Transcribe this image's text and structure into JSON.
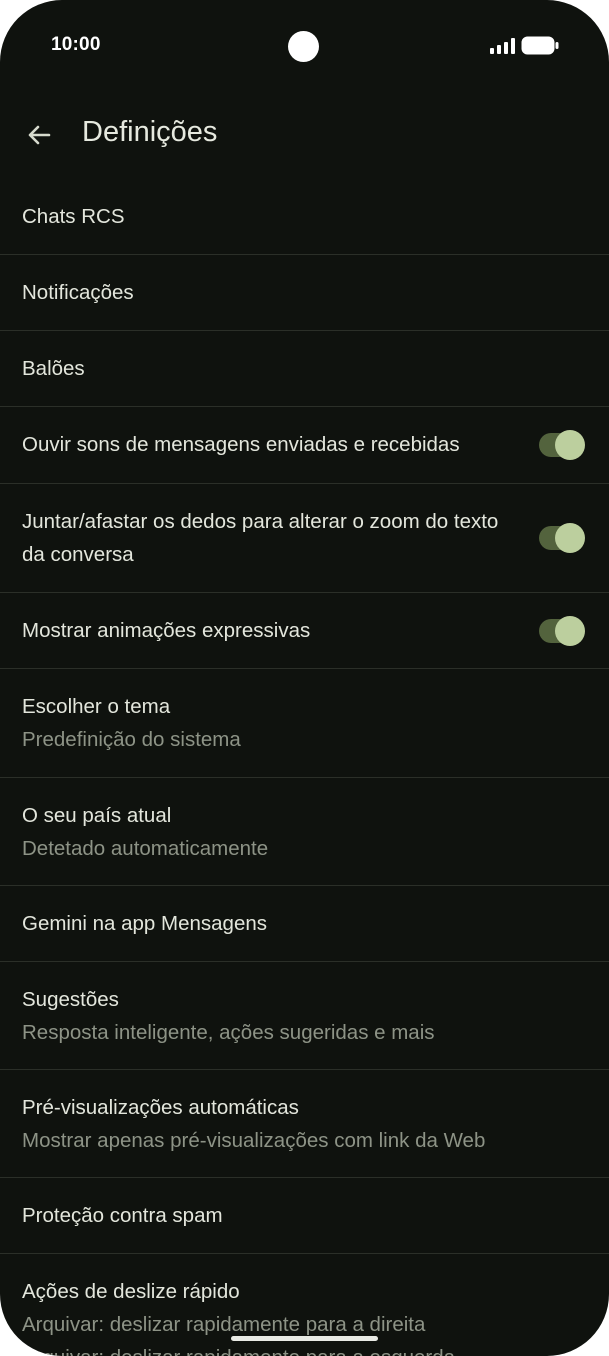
{
  "status_bar": {
    "time": "10:00"
  },
  "header": {
    "title": "Definições"
  },
  "settings": [
    {
      "primary": "Chats RCS"
    },
    {
      "primary": "Notificações"
    },
    {
      "primary": "Balões"
    },
    {
      "primary": "Ouvir sons de mensagens enviadas e recebidas",
      "toggle": true
    },
    {
      "primary": "Juntar/afastar os dedos para alterar o zoom do texto da conversa",
      "toggle": true
    },
    {
      "primary": "Mostrar animações expressivas",
      "toggle": true
    },
    {
      "primary": "Escolher o tema",
      "secondary": "Predefinição do sistema"
    },
    {
      "primary": "O seu país atual",
      "secondary": "Detetado automaticamente"
    },
    {
      "primary": "Gemini na app Mensagens"
    },
    {
      "primary": "Sugestões",
      "secondary": "Resposta inteligente, ações sugeridas e mais"
    },
    {
      "primary": "Pré-visualizações automáticas",
      "secondary": "Mostrar apenas pré-visualizações com link da Web"
    },
    {
      "primary": "Proteção contra spam"
    },
    {
      "primary": "Ações de deslize rápido",
      "secondary": "Arquivar: deslizar rapidamente para a direita",
      "secondary2": "Arquivar: deslizar rapidamente para a esquerda"
    }
  ],
  "colors": {
    "background": "#0f120e",
    "toggle_track": "#53633d",
    "toggle_knob": "#bccf9e",
    "divider": "#2b2f28"
  }
}
